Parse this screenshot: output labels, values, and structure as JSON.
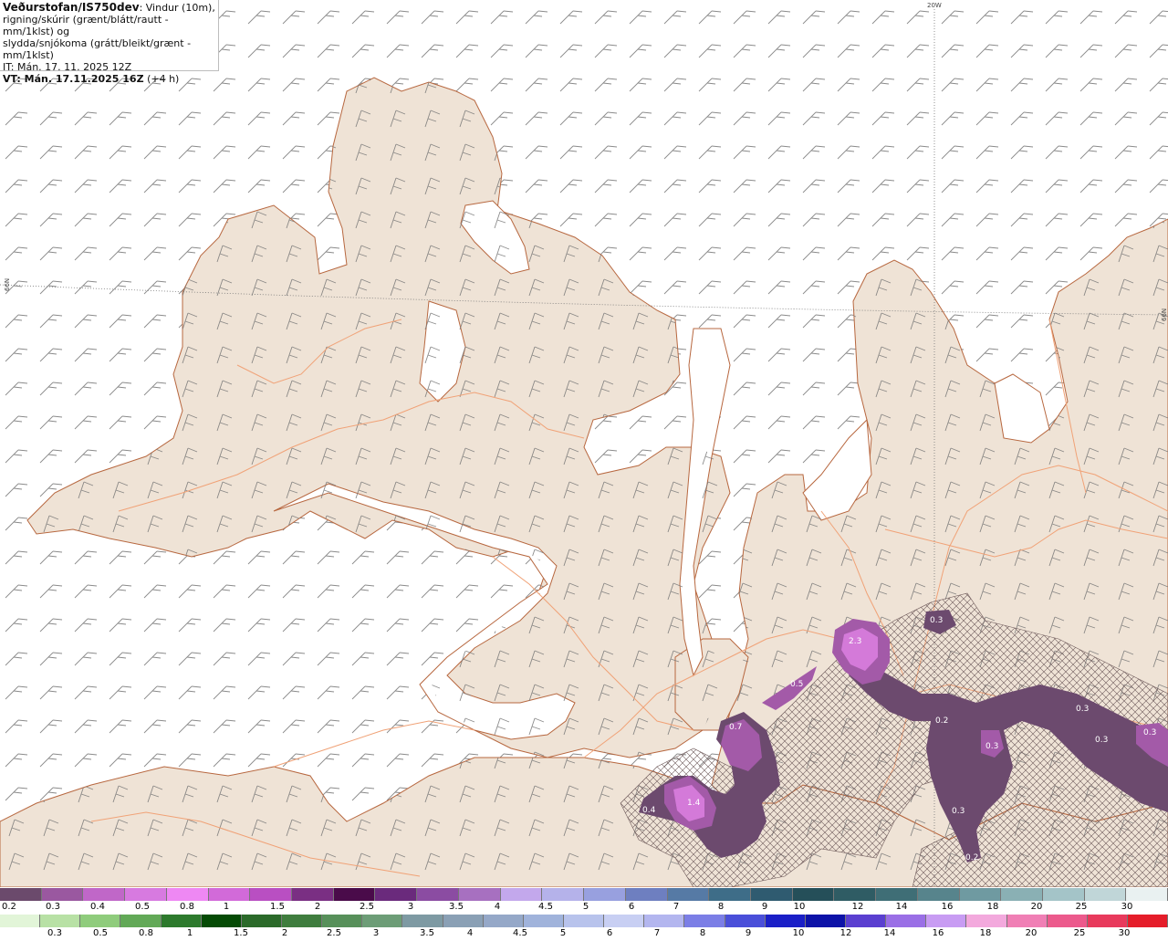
{
  "header": {
    "title": "Veðurstofan/IS750dev",
    "description_line1": ": Vindur (10m),",
    "description_line2": "rigning/skúrir (grænt/blátt/rautt - mm/1klst) og",
    "description_line3": "slydda/snjókoma (grátt/bleikt/grænt - mm/1klst)",
    "issue_time": "IT: Mán. 17. 11. 2025 12Z",
    "valid_time_label": "VT: Mán. 17.11.2025 16Z",
    "valid_time_offset": "(+4 h)"
  },
  "graticule": {
    "meridian_label": "20W",
    "parallel_label_left": "66N",
    "parallel_label_right": "66N"
  },
  "precip_labels": [
    "2.3",
    "0.3",
    "0.5",
    "0.7",
    "1.4",
    "0.4",
    "0.2",
    "0.3",
    "0.3",
    "0.3",
    "0.3",
    "0.3",
    "0.2"
  ],
  "colors": {
    "land": "#efe3d6",
    "sea": "#ffffff",
    "roads": "#f0a277",
    "coast": "#b7673f",
    "sleet_dark": "#6c4a6e",
    "snow_mid": "#a35aa8",
    "snow_light": "#d47ad9",
    "snow_bright": "#ee8ef2"
  },
  "scale_top": {
    "colors": [
      "#6b4a6c",
      "#9a58a0",
      "#c067c8",
      "#d77ae0",
      "#ee88f3",
      "#d26ad9",
      "#b94fc2",
      "#7a2f83",
      "#4a0b4a",
      "#6a2a7c",
      "#8b4ca2",
      "#a770c0",
      "#c3a8ec",
      "#b5b2ea",
      "#98a0df",
      "#6e7fc0",
      "#567aa5",
      "#3e6d88",
      "#2f5b70",
      "#254f59",
      "#2f5c64",
      "#3f6e76",
      "#57848c",
      "#6f9aa1",
      "#8ab0b4",
      "#a4c4c8",
      "#c0d6d8",
      "#e9f1f1"
    ],
    "ticks": [
      "0.2",
      "0.3",
      "0.4",
      "0.5",
      "0.8",
      "1",
      "1.5",
      "2",
      "2.5",
      "3",
      "3.5",
      "4",
      "4.5",
      "5",
      "6",
      "7",
      "8",
      "9",
      "10",
      "12",
      "14",
      "16",
      "18",
      "20",
      "25",
      "30"
    ]
  },
  "scale_bottom": {
    "colors": [
      "#e2f5d8",
      "#b8e1a5",
      "#8fcc7c",
      "#62a957",
      "#2d7a2d",
      "#054b05",
      "#2b6a2a",
      "#3f7d3e",
      "#57905a",
      "#6d9d77",
      "#7e9aa3",
      "#8aa0b5",
      "#95a8c8",
      "#a0b3db",
      "#b8c3ec",
      "#c8cff3",
      "#b3b6ef",
      "#7b7ee6",
      "#4a4fd9",
      "#1a1fc7",
      "#0d12a8",
      "#5a3fd0",
      "#9a6fe6",
      "#c89cf3",
      "#f3a9dd",
      "#f07fb5",
      "#ec5a8c",
      "#e83a5c",
      "#e51d2a"
    ],
    "ticks": [
      "0.3",
      "0.5",
      "0.8",
      "1",
      "1.5",
      "2",
      "2.5",
      "3",
      "3.5",
      "4",
      "4.5",
      "5",
      "6",
      "7",
      "8",
      "9",
      "10",
      "12",
      "14",
      "16",
      "18",
      "20",
      "25",
      "30"
    ]
  }
}
